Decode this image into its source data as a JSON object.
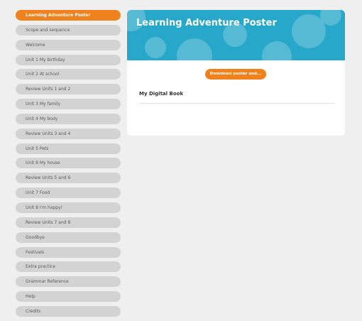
{
  "sidebar": {
    "items": [
      {
        "label": "Learning Adventure Poster",
        "active": true
      },
      {
        "label": "Scope and sequence"
      },
      {
        "label": "Welcome"
      },
      {
        "label": "Unit 1 My birthday"
      },
      {
        "label": "Unit 2 At school"
      },
      {
        "label": "Review Units 1 and 2"
      },
      {
        "label": "Unit 3 My family"
      },
      {
        "label": "Unit 4 My body"
      },
      {
        "label": "Review Units 3 and 4"
      },
      {
        "label": "Unit 5 Pets"
      },
      {
        "label": "Unit 6 My house"
      },
      {
        "label": "Review Units 5 and 6"
      },
      {
        "label": "Unit 7 Food"
      },
      {
        "label": "Unit 8 I'm happy!"
      },
      {
        "label": "Review Units 7 and 8"
      },
      {
        "label": "Goodbye"
      },
      {
        "label": "Festivals"
      },
      {
        "label": "Extra practice"
      },
      {
        "label": "Grammar Reference"
      },
      {
        "label": "Help"
      },
      {
        "label": "Credits"
      }
    ]
  },
  "main": {
    "title": "Learning Adventure Poster",
    "download_label": "Download poster and...",
    "link_label": "My Digital Book"
  },
  "colors": {
    "accent": "#f0821e",
    "banner": "#27a7c9",
    "nav_inactive": "#d3d3d3",
    "background": "#efefef"
  }
}
